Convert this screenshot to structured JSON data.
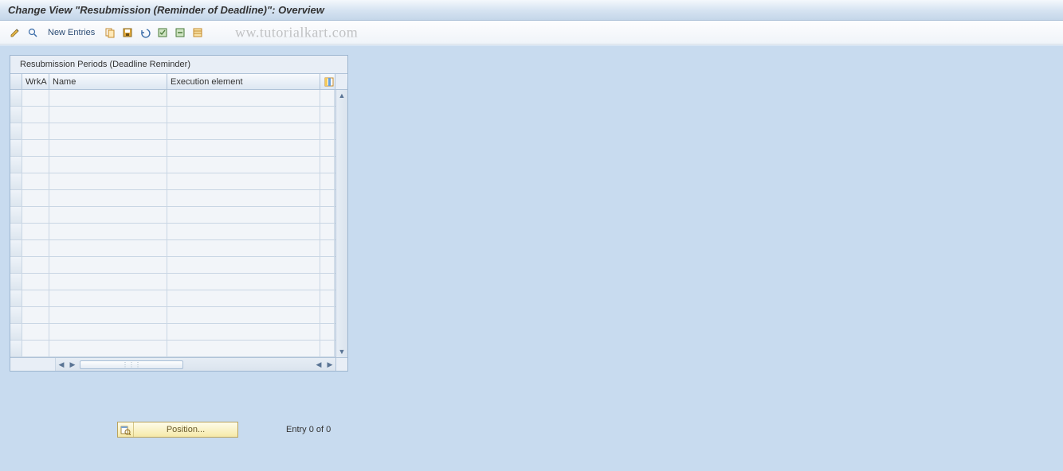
{
  "title": "Change View \"Resubmission (Reminder of Deadline)\": Overview",
  "toolbar": {
    "new_entries_label": "New Entries"
  },
  "watermark": "ww.tutorialkart.com",
  "panel": {
    "title": "Resubmission Periods (Deadline Reminder)",
    "columns": {
      "wrka": "WrkA",
      "name": "Name",
      "exec": "Execution element"
    },
    "rows": []
  },
  "footer": {
    "position_label": "Position...",
    "entry_text": "Entry 0 of 0"
  }
}
